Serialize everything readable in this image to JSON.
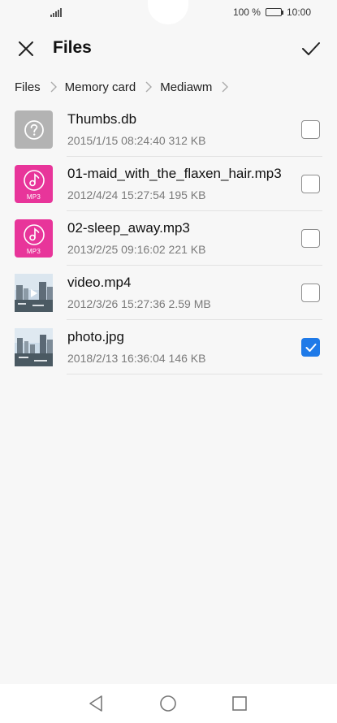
{
  "status_bar": {
    "battery": "100 %",
    "time": "10:00",
    "battery_level": 1.0
  },
  "app_bar": {
    "title": "Files",
    "close_icon": "close-icon",
    "confirm_icon": "checkmark-icon"
  },
  "breadcrumb": [
    "Files",
    "Memory card",
    "Mediawm"
  ],
  "files": [
    {
      "name": "Thumbs.db",
      "meta": "2015/1/15 08:24:40 312 KB",
      "type": "unknown",
      "checked": false
    },
    {
      "name": "01-maid_with_the_flaxen_hair.mp3",
      "meta": "2012/4/24 15:27:54 195 KB",
      "type": "mp3",
      "badge": "MP3",
      "checked": false
    },
    {
      "name": "02-sleep_away.mp3",
      "meta": "2013/2/25 09:16:02 221 KB",
      "type": "mp3",
      "badge": "MP3",
      "checked": false
    },
    {
      "name": "video.mp4",
      "meta": "2012/3/26 15:27:36 2.59 MB",
      "type": "video",
      "checked": false
    },
    {
      "name": "photo.jpg",
      "meta": "2018/2/13 16:36:04 146 KB",
      "type": "photo",
      "checked": true
    }
  ],
  "colors": {
    "accent": "#1f7ae8",
    "mp3_badge": "#e8359a",
    "unknown_thumb": "#b3b3b3"
  },
  "nav_bar": [
    "back-icon",
    "home-icon",
    "recents-icon"
  ]
}
